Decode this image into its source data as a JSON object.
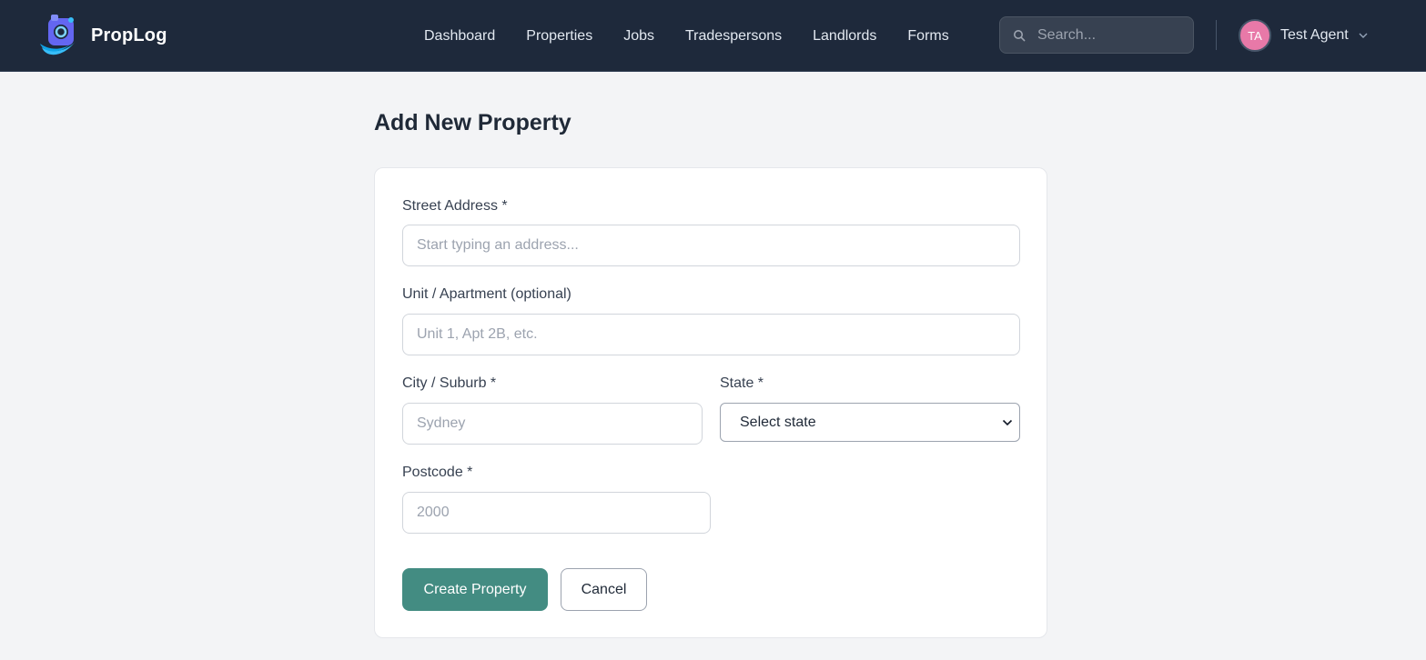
{
  "app": {
    "name": "PropLog"
  },
  "nav": {
    "items": [
      {
        "label": "Dashboard"
      },
      {
        "label": "Properties"
      },
      {
        "label": "Jobs"
      },
      {
        "label": "Tradespersons"
      },
      {
        "label": "Landlords"
      },
      {
        "label": "Forms"
      }
    ]
  },
  "search": {
    "placeholder": "Search..."
  },
  "user": {
    "initials": "TA",
    "name": "Test Agent"
  },
  "page": {
    "title": "Add New Property"
  },
  "form": {
    "street": {
      "label": "Street Address *",
      "placeholder": "Start typing an address..."
    },
    "unit": {
      "label": "Unit / Apartment (optional)",
      "placeholder": "Unit 1, Apt 2B, etc."
    },
    "city": {
      "label": "City / Suburb *",
      "placeholder": "Sydney"
    },
    "state": {
      "label": "State *",
      "value": "Select state"
    },
    "postcode": {
      "label": "Postcode *",
      "placeholder": "2000"
    },
    "submit_label": "Create Property",
    "cancel_label": "Cancel"
  },
  "colors": {
    "topbar": "#1e293b",
    "primary": "#438c82",
    "avatar": "#e879a8",
    "background": "#f3f4f6"
  },
  "icons": {
    "logo": "proplog-logo-icon",
    "search": "search-icon",
    "user_menu": "chevron-down-icon",
    "state_select": "chevron-down-icon"
  }
}
